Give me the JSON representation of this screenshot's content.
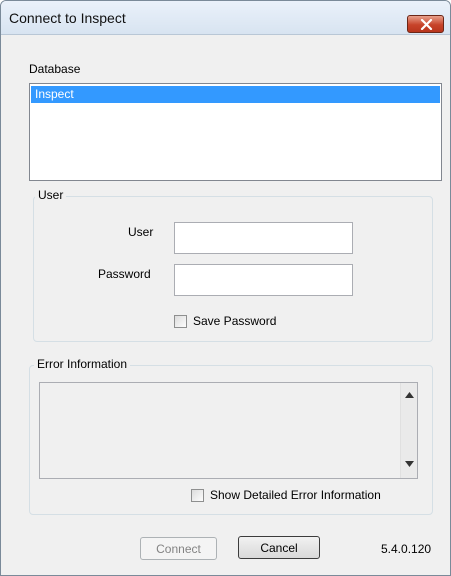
{
  "window": {
    "title": "Connect to Inspect"
  },
  "database": {
    "label": "Database",
    "items": [
      "Inspect"
    ],
    "selected_index": 0
  },
  "user_group": {
    "title": "User",
    "user_label": "User",
    "user_value": "",
    "password_label": "Password",
    "password_value": "",
    "save_password_label": "Save Password",
    "save_password_checked": false
  },
  "error_group": {
    "title": "Error Information",
    "text": "",
    "show_detailed_label": "Show Detailed Error Information",
    "show_detailed_checked": false
  },
  "buttons": {
    "connect_label": "Connect",
    "connect_enabled": false,
    "cancel_label": "Cancel"
  },
  "version": "5.4.0.120",
  "colors": {
    "selection": "#3399ff",
    "close_button": "#c7442a",
    "window_bg": "#f0f0f0"
  }
}
